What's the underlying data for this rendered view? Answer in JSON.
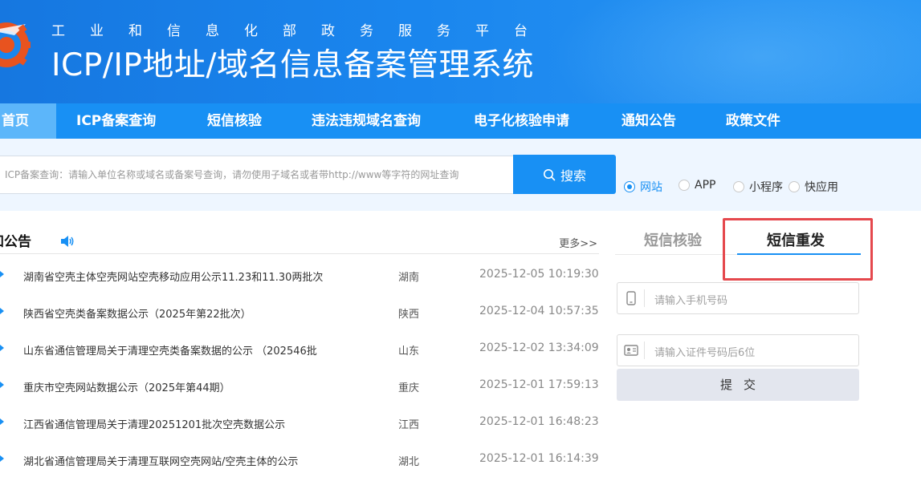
{
  "header": {
    "subtitle": "工业和信息化部政务服务平台",
    "title": "ICP/IP地址/域名信息备案管理系统"
  },
  "nav": {
    "items": [
      {
        "label": "首页",
        "active": true
      },
      {
        "label": "ICP备案查询"
      },
      {
        "label": "短信核验"
      },
      {
        "label": "违法违规域名查询"
      },
      {
        "label": "电子化核验申请"
      },
      {
        "label": "通知公告"
      },
      {
        "label": "政策文件"
      }
    ]
  },
  "search": {
    "placeholder": "ICP备案查询：请输入单位名称或域名或备案号查询，请勿使用子域名或者带http://www等字符的网址查询",
    "button_label": "搜索",
    "options": [
      {
        "label": "网站",
        "checked": true
      },
      {
        "label": "APP"
      },
      {
        "label": "小程序"
      },
      {
        "label": "快应用"
      }
    ]
  },
  "notices": {
    "title": "知公告",
    "more_label": "更多>>",
    "items": [
      {
        "title": "湖南省空壳主体空壳网站空壳移动应用公示11.23和11.30两批次",
        "region": "湖南",
        "time": "2025-12-05 10:19:30"
      },
      {
        "title": "陕西省空壳类备案数据公示（2025年第22批次）",
        "region": "陕西",
        "time": "2025-12-04 10:57:35"
      },
      {
        "title": "山东省通信管理局关于清理空壳类备案数据的公示 （202546批",
        "region": "山东",
        "time": "2025-12-02 13:34:09"
      },
      {
        "title": "重庆市空壳网站数据公示（2025年第44期）",
        "region": "重庆",
        "time": "2025-12-01 17:59:13"
      },
      {
        "title": "江西省通信管理局关于清理20251201批次空壳数据公示",
        "region": "江西",
        "time": "2025-12-01 16:48:23"
      },
      {
        "title": "湖北省通信管理局关于清理互联网空壳网站/空壳主体的公示",
        "region": "湖北",
        "time": "2025-12-01 16:14:39"
      }
    ]
  },
  "sms": {
    "tabs": [
      {
        "label": "短信核验",
        "active": false
      },
      {
        "label": "短信重发",
        "active": true
      }
    ],
    "phone_placeholder": "请输入手机号码",
    "id_placeholder": "请输入证件号码后6位",
    "submit_label": "提交"
  },
  "colors": {
    "primary": "#1890f4",
    "nav_active": "#5cb6fa",
    "highlight": "#e5484d",
    "search_band": "#eef6ff"
  }
}
